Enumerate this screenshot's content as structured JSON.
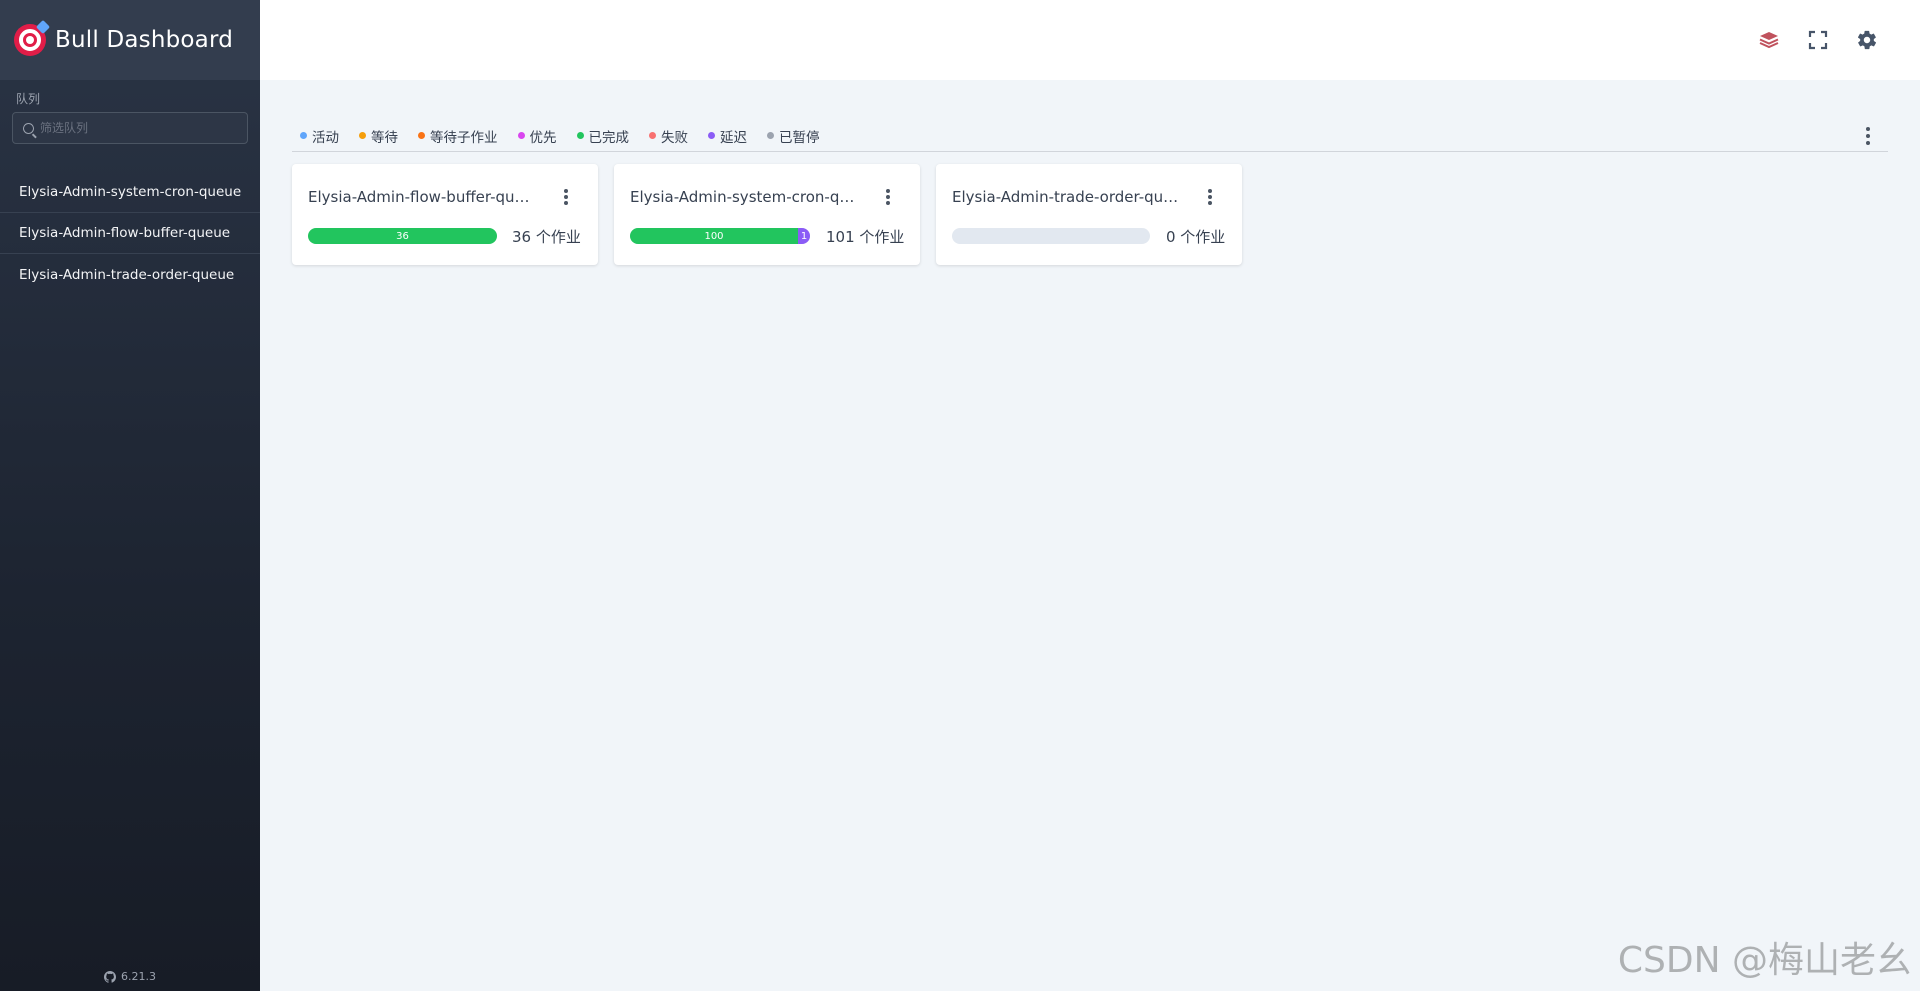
{
  "app": {
    "title": "Bull Dashboard",
    "version": "6.21.3"
  },
  "sidebar": {
    "section_label": "队列",
    "filter_placeholder": "筛选队列",
    "queues": [
      {
        "label": "Elysia-Admin-system-cron-queue"
      },
      {
        "label": "Elysia-Admin-flow-buffer-queue"
      },
      {
        "label": "Elysia-Admin-trade-order-queue"
      }
    ]
  },
  "header": {
    "icons": [
      "redis-icon",
      "fullscreen-icon",
      "settings-icon"
    ]
  },
  "statuses": [
    {
      "label": "活动",
      "color": "#60a5fa"
    },
    {
      "label": "等待",
      "color": "#f59e0b"
    },
    {
      "label": "等待子作业",
      "color": "#f97316"
    },
    {
      "label": "优先",
      "color": "#d946ef"
    },
    {
      "label": "已完成",
      "color": "#22c55e"
    },
    {
      "label": "失败",
      "color": "#f87171"
    },
    {
      "label": "延迟",
      "color": "#8b5cf6"
    },
    {
      "label": "已暂停",
      "color": "#9ca3af"
    }
  ],
  "cards": [
    {
      "name": "Elysia-Admin-flow-buffer-queue",
      "completed": "36",
      "delayed": "",
      "jobs": "36 个作业"
    },
    {
      "name": "Elysia-Admin-system-cron-queue",
      "completed": "100",
      "delayed": "1",
      "jobs": "101 个作业"
    },
    {
      "name": "Elysia-Admin-trade-order-queue",
      "completed": "",
      "delayed": "",
      "jobs": "0 个作业"
    }
  ],
  "colors": {
    "completed": "#22c55e",
    "delayed": "#8b5cf6",
    "empty": "#e2e8f0"
  },
  "watermark": "CSDN @梅山老幺"
}
